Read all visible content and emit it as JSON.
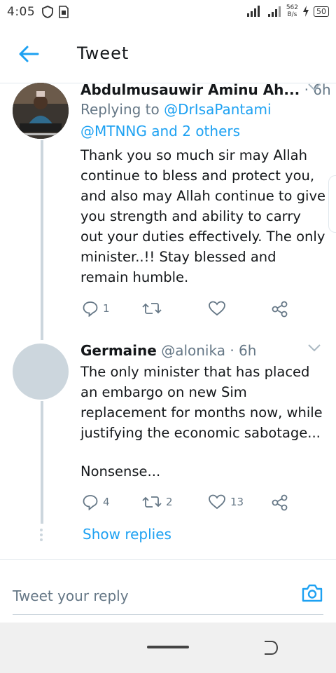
{
  "status_bar": {
    "time": "4:05",
    "net_speed_value": "562",
    "net_speed_unit": "B/s",
    "battery": "50",
    "icons": [
      "shield-icon",
      "sim-card-icon",
      "signal-icon",
      "signal-icon",
      "charging-icon"
    ]
  },
  "app_bar": {
    "title": "Tweet",
    "back_icon": "arrow-left-icon"
  },
  "tweets": [
    {
      "name": "Abdulmusauwir Aminu Ah...",
      "handle": "",
      "time": "· 6h",
      "replying_prefix": "Replying to ",
      "replying_to_first": "@DrIsaPantami",
      "replying_to_rest": "@MTNNG and 2 others",
      "text": "Thank you so much sir may Allah continue to bless and protect you, and also may Allah continue to give you strength and ability to carry out your duties effectively. The only minister..!! Stay blessed and remain humble.",
      "reply_count": "1",
      "retweet_count": "",
      "like_count": ""
    },
    {
      "name": "Germaine",
      "handle": "@alonika",
      "time": "· 6h",
      "text_lines": [
        "The only minister that has placed an embargo on new Sim replacement for months now, while justifying the economic sabotage...",
        "Nonsense..."
      ],
      "reply_count": "4",
      "retweet_count": "2",
      "like_count": "13"
    }
  ],
  "show_replies": "Show replies",
  "reply_input": {
    "placeholder": "Tweet your reply"
  },
  "colors": {
    "accent": "#1da1f2",
    "text": "#14171a",
    "muted": "#657786",
    "divider": "#e1e8ed"
  }
}
